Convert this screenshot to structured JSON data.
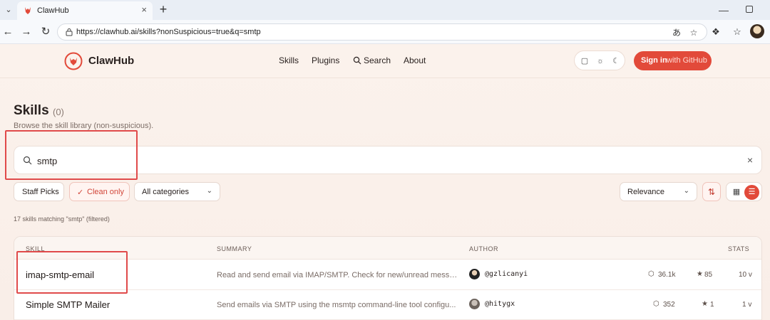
{
  "browser": {
    "tab_title": "ClawHub",
    "url": "https://clawhub.ai/skills?nonSuspicious=true&q=smtp"
  },
  "header": {
    "brand": "ClawHub",
    "nav": [
      "Skills",
      "Plugins",
      "Search",
      "About"
    ],
    "signin_main": "Sign in",
    "signin_sub": "with GitHub"
  },
  "page": {
    "title": "Skills",
    "count": "(0)",
    "subtitle": "Browse the skill library (non-suspicious)."
  },
  "search": {
    "value": "smtp"
  },
  "filters": {
    "staff_picks": "Staff Picks",
    "clean_only": "Clean only",
    "categories": "All categories",
    "sort": "Relevance"
  },
  "results": {
    "count_text": "17 skills matching \"smtp\" (filtered)",
    "columns": [
      "SKILL",
      "SUMMARY",
      "AUTHOR",
      "STATS"
    ],
    "rows": [
      {
        "skill": "imap-smtp-email",
        "summary": "Read and send email via IMAP/SMTP. Check for new/unread messa...",
        "author": "@gzlicanyi",
        "downloads": "36.1k",
        "stars": "85",
        "versions": "10 v"
      },
      {
        "skill": "Simple SMTP Mailer",
        "summary": "Send emails via SMTP using the msmtp command-line tool configu...",
        "author": "@hitygx",
        "downloads": "352",
        "stars": "1",
        "versions": "1 v"
      }
    ]
  },
  "colors": {
    "accent": "#e24a3a",
    "highlight_box": "#e04a4a"
  }
}
